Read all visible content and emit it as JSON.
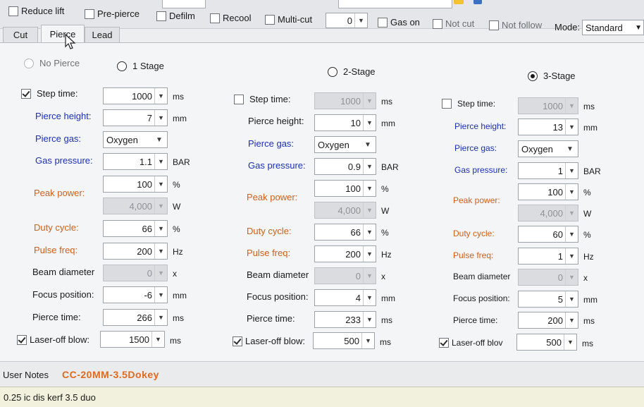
{
  "toolbar": {
    "reduce_lift": "Reduce lift",
    "pre_pierce": "Pre-pierce",
    "defilm": "Defilm",
    "recool": "Recool",
    "multi_cut": "Multi-cut",
    "multi_cut_value": "0",
    "gas_on": "Gas on",
    "not_cut": "Not cut",
    "not_follow": "Not follow",
    "mode_label": "Mode:",
    "mode_value": "Standard"
  },
  "tabs": {
    "cut": "Cut",
    "pierce": "Pierce",
    "lead": "Lead",
    "active": "pierce"
  },
  "radios": {
    "no_pierce": "No Pierce",
    "stage1": "1 Stage",
    "stage2": "2-Stage",
    "stage3": "3-Stage",
    "selected": "3-Stage"
  },
  "labels": {
    "step_time": "Step time:",
    "pierce_height": "Pierce height:",
    "pierce_gas": "Pierce gas:",
    "gas_pressure": "Gas pressure:",
    "peak_power": "Peak power:",
    "duty_cycle": "Duty cycle:",
    "pulse_freq": "Pulse freq:",
    "beam_diameter": "Beam diameter",
    "focus_position": "Focus position:",
    "pierce_time": "Pierce time:",
    "laser_off_blow": "Laser-off blow:",
    "laser_off_blow_short": "Laser-off blov"
  },
  "units": {
    "ms": "ms",
    "mm": "mm",
    "bar": "BAR",
    "pct": "%",
    "w": "W",
    "hz": "Hz",
    "x": "x"
  },
  "stages": [
    {
      "step_time_checked": true,
      "step_time": "1000",
      "pierce_height": "7",
      "pierce_gas": "Oxygen",
      "gas_pressure": "1.1",
      "peak_power_pct": "100",
      "peak_power_w": "4,000",
      "duty_cycle": "66",
      "pulse_freq": "200",
      "beam_diameter": "0",
      "focus_position": "-6",
      "pierce_time": "266",
      "laser_off_blow_checked": true,
      "laser_off_blow": "1500"
    },
    {
      "step_time_checked": false,
      "step_time": "1000",
      "pierce_height": "10",
      "pierce_gas": "Oxygen",
      "gas_pressure": "0.9",
      "peak_power_pct": "100",
      "peak_power_w": "4,000",
      "duty_cycle": "66",
      "pulse_freq": "200",
      "beam_diameter": "0",
      "focus_position": "4",
      "pierce_time": "233",
      "laser_off_blow_checked": true,
      "laser_off_blow": "500"
    },
    {
      "step_time_checked": false,
      "step_time": "1000",
      "pierce_height": "13",
      "pierce_gas": "Oxygen",
      "gas_pressure": "1",
      "peak_power_pct": "100",
      "peak_power_w": "4,000",
      "duty_cycle": "60",
      "pulse_freq": "1",
      "beam_diameter": "0",
      "focus_position": "5",
      "pierce_time": "200",
      "laser_off_blow_checked": true,
      "laser_off_blow": "500"
    }
  ],
  "notes": {
    "label": "User Notes",
    "value": "CC-20MM-3.5Dokey"
  },
  "status_text": "0.25 ic dis kerf 3.5 duo",
  "colors": {
    "blue_label": "#1b2fb8",
    "orange_label": "#d25f1a",
    "notes_accent": "#e06a1e",
    "status_bg": "#f2f1dd"
  }
}
